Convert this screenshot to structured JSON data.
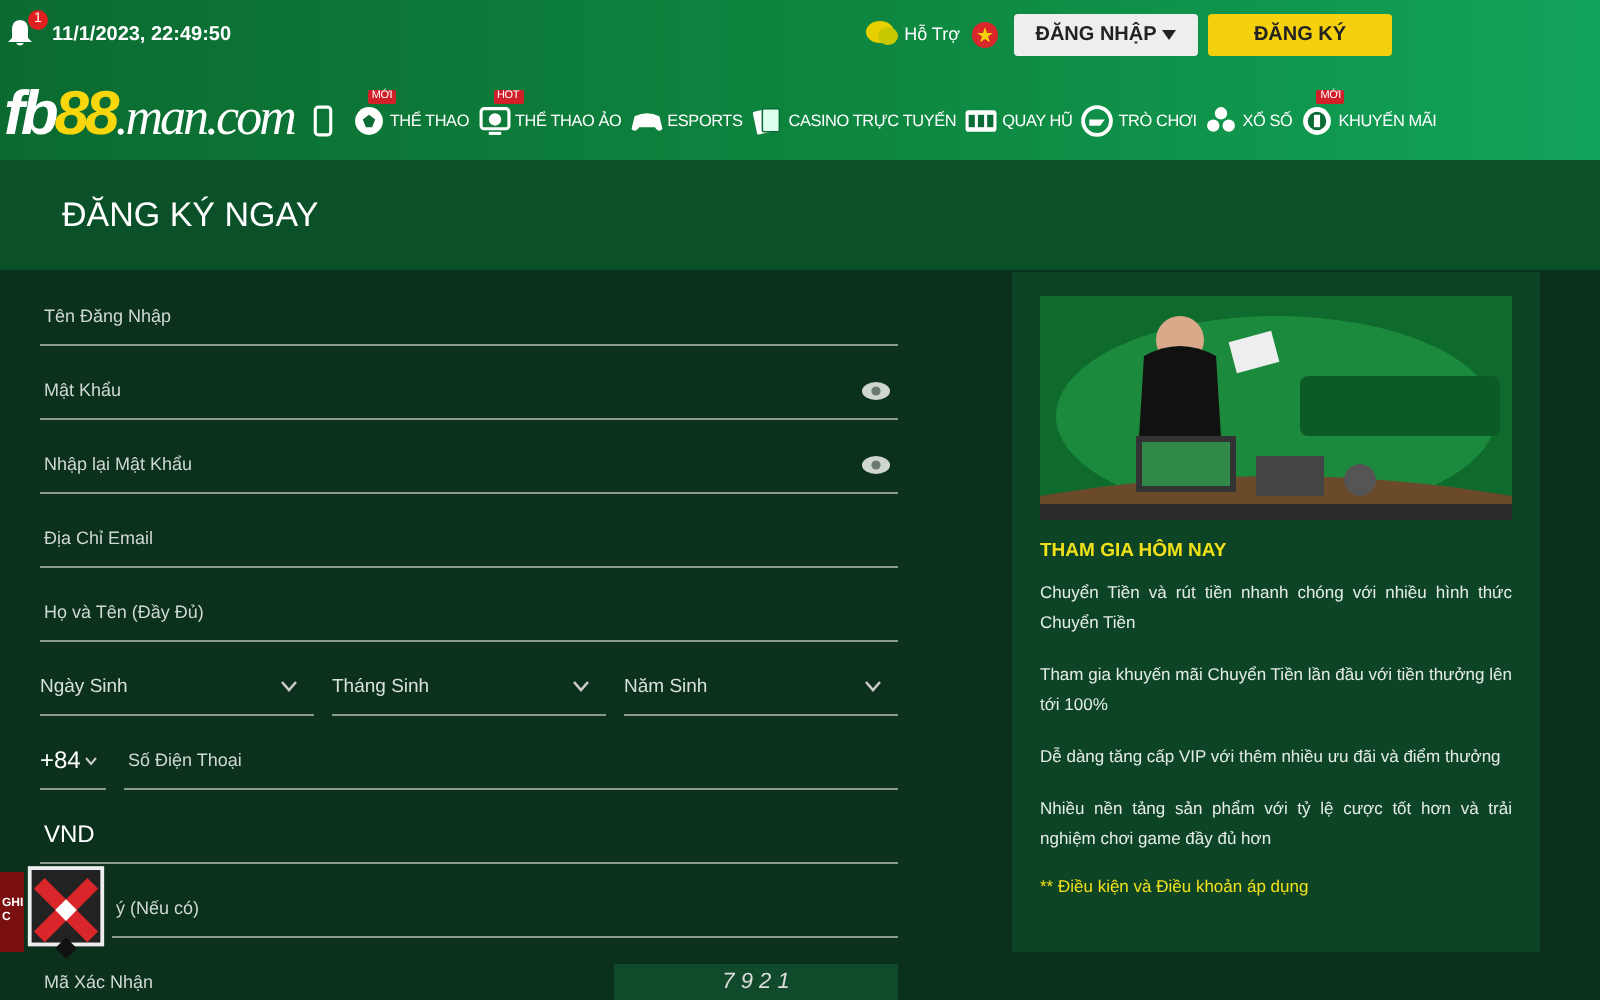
{
  "top": {
    "time": "11/1/2023, 22:49:50",
    "notifications": "1",
    "support": "Hỗ Trợ",
    "login": "ĐĂNG NHẬP",
    "register": "ĐĂNG KÝ"
  },
  "logo": {
    "part1": "fb",
    "part2": "88",
    "part3": ".man.com"
  },
  "nav": [
    {
      "kind": "icon"
    },
    {
      "kind": "link",
      "label": "THỂ THAO",
      "badge": "MỚI"
    },
    {
      "kind": "link",
      "label": "THỂ THAO ẢO",
      "badge": "HOT"
    },
    {
      "kind": "link",
      "label": "ESPORTS"
    },
    {
      "kind": "link",
      "label": "CASINO TRỰC TUYẾN"
    },
    {
      "kind": "link",
      "label": "QUAY HŨ"
    },
    {
      "kind": "link",
      "label": "TRÒ CHƠI"
    },
    {
      "kind": "link",
      "label": "XỔ SỐ"
    },
    {
      "kind": "link",
      "label": "KHUYẾN MÃI",
      "badge": "MỚI"
    }
  ],
  "title": "ĐĂNG KÝ NGAY",
  "form": [
    {
      "kind": "text",
      "placeholder": "Tên Đăng Nhập"
    },
    {
      "kind": "password",
      "placeholder": "Mật Khẩu"
    },
    {
      "kind": "password",
      "placeholder": "Nhập lại Mật Khẩu"
    },
    {
      "kind": "text",
      "placeholder": "Địa Chỉ Email"
    },
    {
      "kind": "text",
      "placeholder": "Họ và Tên (Đầy Đủ)"
    },
    {
      "kind": "selects",
      "items": [
        "Ngày Sinh",
        "Tháng Sinh",
        "Năm Sinh"
      ]
    },
    {
      "kind": "phone",
      "prefix": "+84",
      "placeholder": "Số Điện Thoại"
    },
    {
      "kind": "value",
      "value": "VND"
    },
    {
      "kind": "text",
      "placeholder": "ý (Nếu có)"
    },
    {
      "kind": "captcha",
      "placeholder": "Mã Xác Nhận",
      "code": "7 9 2 1"
    }
  ],
  "promo": {
    "heading": "THAM GIA HÔM NAY",
    "paragraphs": [
      "Chuyển Tiền và rút tiền nhanh chóng với nhiều hình thức Chuyển Tiền",
      "Tham gia khuyến mãi Chuyển Tiền lần đầu với tiền thưởng lên tới 100%",
      "Dễ dàng tăng cấp VIP với thêm nhiều ưu đãi và điểm thưởng",
      "Nhiều nền tảng sản phẩm với tỷ lệ cược tốt hơn và trải nghiệm chơi game đầy đủ hơn"
    ],
    "footnote": "** Điều kiện và Điều khoản áp dụng"
  },
  "floating_badge": {
    "lines": [
      "GHI",
      "C"
    ]
  }
}
